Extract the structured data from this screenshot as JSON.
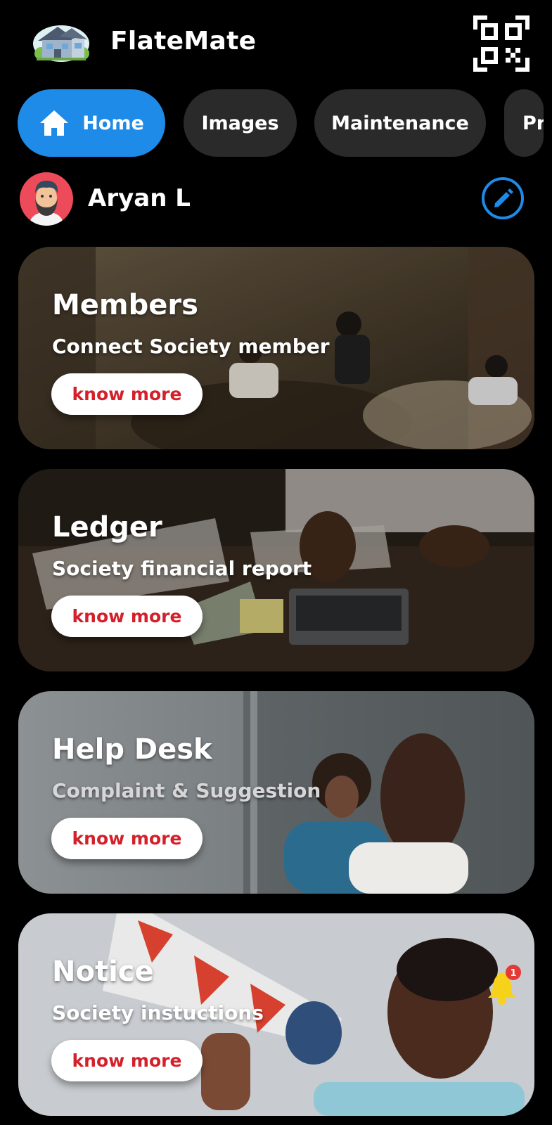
{
  "app": {
    "title": "FlateMate"
  },
  "tabs": [
    {
      "label": "Home",
      "icon": "home-icon",
      "active": true
    },
    {
      "label": "Images",
      "active": false
    },
    {
      "label": "Maintenance",
      "active": false
    },
    {
      "label": "Pr",
      "active": false
    }
  ],
  "user": {
    "name": "Aryan L"
  },
  "cards": [
    {
      "title": "Members",
      "subtitle": "Connect Society member",
      "button": "know more"
    },
    {
      "title": "Ledger",
      "subtitle": "Society financial report",
      "button": "know more"
    },
    {
      "title": "Help Desk",
      "subtitle": "Complaint & Suggestion",
      "button": "know more"
    },
    {
      "title": "Notice",
      "subtitle": "Society instuctions",
      "button": "know more",
      "notification_count": "1"
    }
  ],
  "colors": {
    "accent": "#1f8be8",
    "tab_bg": "#2a2a2a",
    "button_text": "#d4202a",
    "background": "#000000",
    "bell": "#f7d21a",
    "badge": "#e53935"
  },
  "icons": [
    "house-logo-icon",
    "qr-code-icon",
    "home-icon",
    "avatar-icon",
    "pencil-icon",
    "bell-icon"
  ]
}
